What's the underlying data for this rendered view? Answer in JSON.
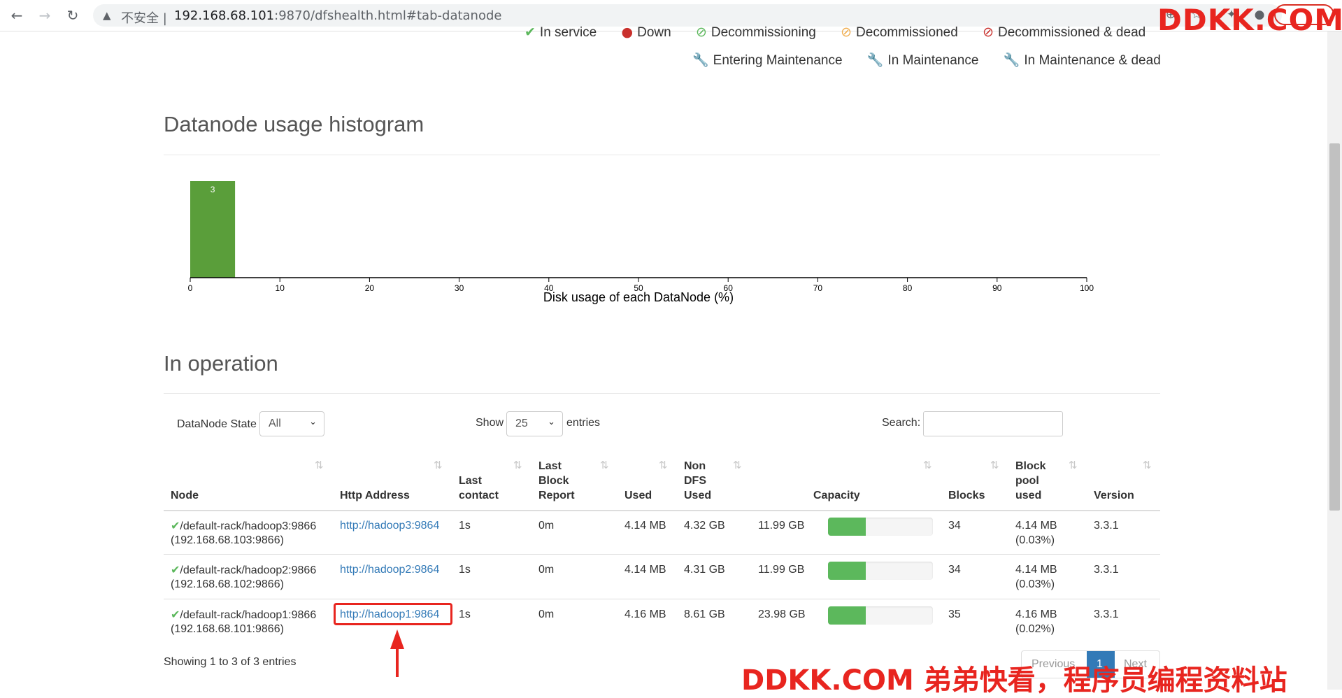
{
  "browser": {
    "security_label": "不安全 |",
    "url_host": "192.168.68.101",
    "url_rest": ":9870/dfshealth.html#tab-datanode"
  },
  "legend": {
    "in_service": "In service",
    "down": "Down",
    "decommissioning": "Decommissioning",
    "decommissioned": "Decommissioned",
    "decommissioned_dead": "Decommissioned & dead",
    "entering_maintenance": "Entering Maintenance",
    "in_maintenance": "In Maintenance",
    "in_maintenance_dead": "In Maintenance & dead"
  },
  "histogram": {
    "title": "Datanode usage histogram",
    "chart_data": {
      "type": "bar",
      "bins": [
        [
          0,
          5
        ]
      ],
      "values": [
        3
      ],
      "bar_labels": [
        "3"
      ],
      "xlabel": "Disk usage of each DataNode (%)",
      "xlim": [
        0,
        100
      ],
      "xticks": [
        "0",
        "10",
        "20",
        "30",
        "40",
        "50",
        "60",
        "70",
        "80",
        "90",
        "100"
      ],
      "color": "#5a9e3a"
    }
  },
  "operation": {
    "title": "In operation",
    "state_label": "DataNode State",
    "state_value": "All",
    "show_label": "Show",
    "show_value": "25",
    "entries_label": "entries",
    "search_label": "Search:",
    "columns": {
      "node": "Node",
      "http": "Http Address",
      "last_contact": [
        "Last",
        "contact"
      ],
      "last_block": [
        "Last",
        "Block",
        "Report"
      ],
      "used": "Used",
      "non_dfs": [
        "Non",
        "DFS",
        "Used"
      ],
      "capacity": "Capacity",
      "blocks": "Blocks",
      "block_pool": [
        "Block",
        "pool",
        "used"
      ],
      "version": "Version"
    },
    "rows": [
      {
        "node": "/default-rack/hadoop3:9866",
        "node_ip": "(192.168.68.103:9866)",
        "http": "http://hadoop3:9864",
        "last_contact": "1s",
        "last_block": "0m",
        "used": "4.14 MB",
        "non_dfs": "4.32 GB",
        "capacity": "11.99 GB",
        "capacity_fraction": 0.36,
        "blocks": "34",
        "pool_used": "4.14 MB",
        "pool_pct": "(0.03%)",
        "version": "3.3.1"
      },
      {
        "node": "/default-rack/hadoop2:9866",
        "node_ip": "(192.168.68.102:9866)",
        "http": "http://hadoop2:9864",
        "last_contact": "1s",
        "last_block": "0m",
        "used": "4.14 MB",
        "non_dfs": "4.31 GB",
        "capacity": "11.99 GB",
        "capacity_fraction": 0.36,
        "blocks": "34",
        "pool_used": "4.14 MB",
        "pool_pct": "(0.03%)",
        "version": "3.3.1"
      },
      {
        "node": "/default-rack/hadoop1:9866",
        "node_ip": "(192.168.68.101:9866)",
        "http": "http://hadoop1:9864",
        "last_contact": "1s",
        "last_block": "0m",
        "used": "4.16 MB",
        "non_dfs": "8.61 GB",
        "capacity": "23.98 GB",
        "capacity_fraction": 0.36,
        "blocks": "35",
        "pool_used": "4.16 MB",
        "pool_pct": "(0.02%)",
        "version": "3.3.1"
      }
    ],
    "footer": "Showing 1 to 3 of 3 entries",
    "pager": {
      "previous": "Previous",
      "page": "1",
      "next": "Next"
    }
  },
  "watermarks": {
    "top": "DDKK.COM",
    "bottom": "DDKK.COM 弟弟快看，程序员编程资料站"
  },
  "colors": {
    "accent": "#e8251f",
    "link": "#337ab7",
    "ok": "#5cb85c"
  }
}
